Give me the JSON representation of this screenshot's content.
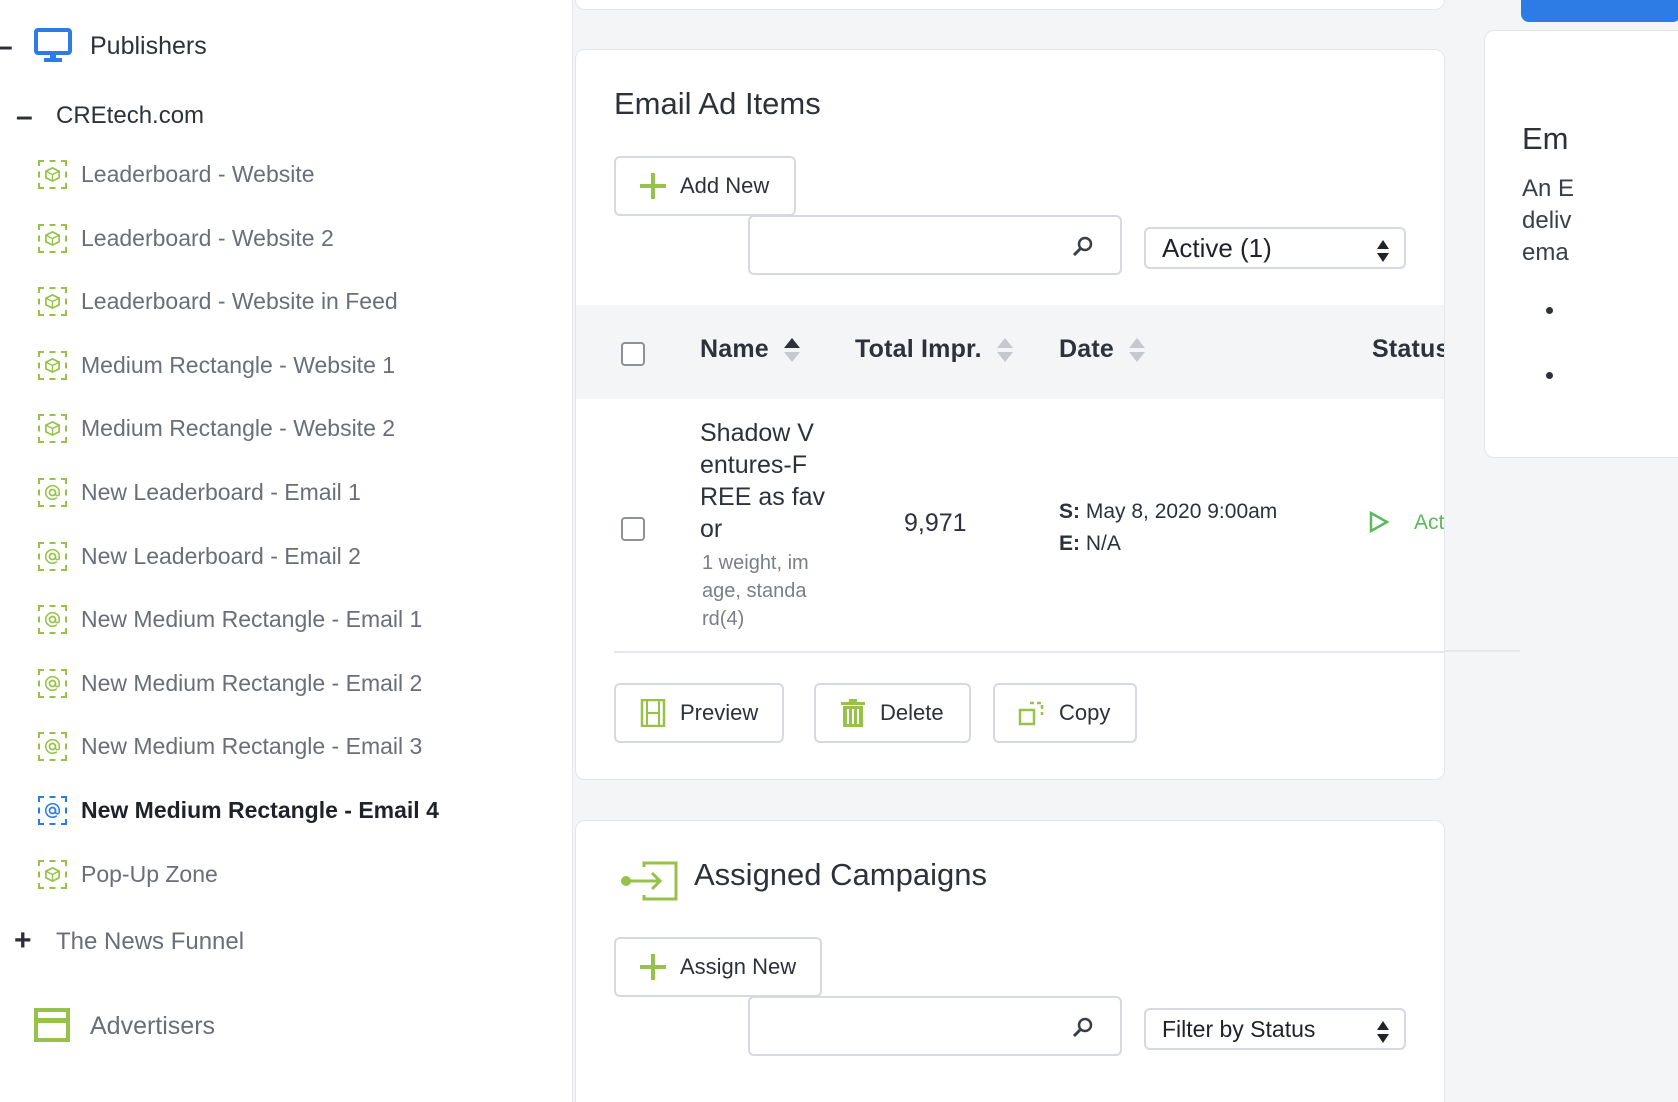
{
  "sidebar": {
    "publishers_label": "Publishers",
    "publishers_toggle": "–",
    "site": {
      "label": "CREtech.com",
      "toggle": "–"
    },
    "zones": [
      {
        "label": "Leaderboard - Website",
        "icon": "cube-icon"
      },
      {
        "label": "Leaderboard - Website 2",
        "icon": "cube-icon"
      },
      {
        "label": "Leaderboard - Website in Feed",
        "icon": "cube-icon"
      },
      {
        "label": "Medium Rectangle - Website 1",
        "icon": "cube-icon"
      },
      {
        "label": "Medium Rectangle - Website 2",
        "icon": "cube-icon"
      },
      {
        "label": "New Leaderboard - Email 1",
        "icon": "at-sign-icon"
      },
      {
        "label": "New Leaderboard - Email 2",
        "icon": "at-sign-icon"
      },
      {
        "label": "New Medium Rectangle - Email 1",
        "icon": "at-sign-icon"
      },
      {
        "label": "New Medium Rectangle - Email 2",
        "icon": "at-sign-icon"
      },
      {
        "label": "New Medium Rectangle - Email 3",
        "icon": "at-sign-icon"
      },
      {
        "label": "New Medium Rectangle - Email 4",
        "icon": "at-sign-icon",
        "active": true
      },
      {
        "label": "Pop-Up Zone",
        "icon": "cube-icon"
      }
    ],
    "other_site": {
      "label": "The News Funnel",
      "toggle": "+"
    },
    "advertisers_label": "Advertisers"
  },
  "email_ad_items": {
    "title": "Email Ad Items",
    "add_new_label": "Add New",
    "search_placeholder": "",
    "status_filter": "Active (1)",
    "columns": {
      "name": "Name",
      "total_impr": "Total Impr.",
      "date": "Date",
      "status": "Status"
    },
    "row": {
      "name_lines": [
        "Shadow V",
        "entures-F",
        "REE as fav",
        "or"
      ],
      "meta_lines": [
        "1 weight, im",
        "age, standa",
        "rd(4)"
      ],
      "total_impr": "9,971",
      "start_key": "S:",
      "start_value": "May 8, 2020 9:00am",
      "end_key": "E:",
      "end_value": "N/A",
      "status": "Active"
    },
    "preview_label": "Preview",
    "delete_label": "Delete",
    "copy_label": "Copy"
  },
  "assigned_campaigns": {
    "title": "Assigned Campaigns",
    "assign_new_label": "Assign New",
    "status_filter": "Filter by Status"
  },
  "right_panel": {
    "title": "Em",
    "text_lines": [
      "An E",
      "deliv",
      "ema"
    ]
  },
  "colors": {
    "accent_green": "#97c24a",
    "active_blue": "#2d7be5",
    "status_green": "#5cb85c",
    "primary_button": "#2d7be5"
  }
}
